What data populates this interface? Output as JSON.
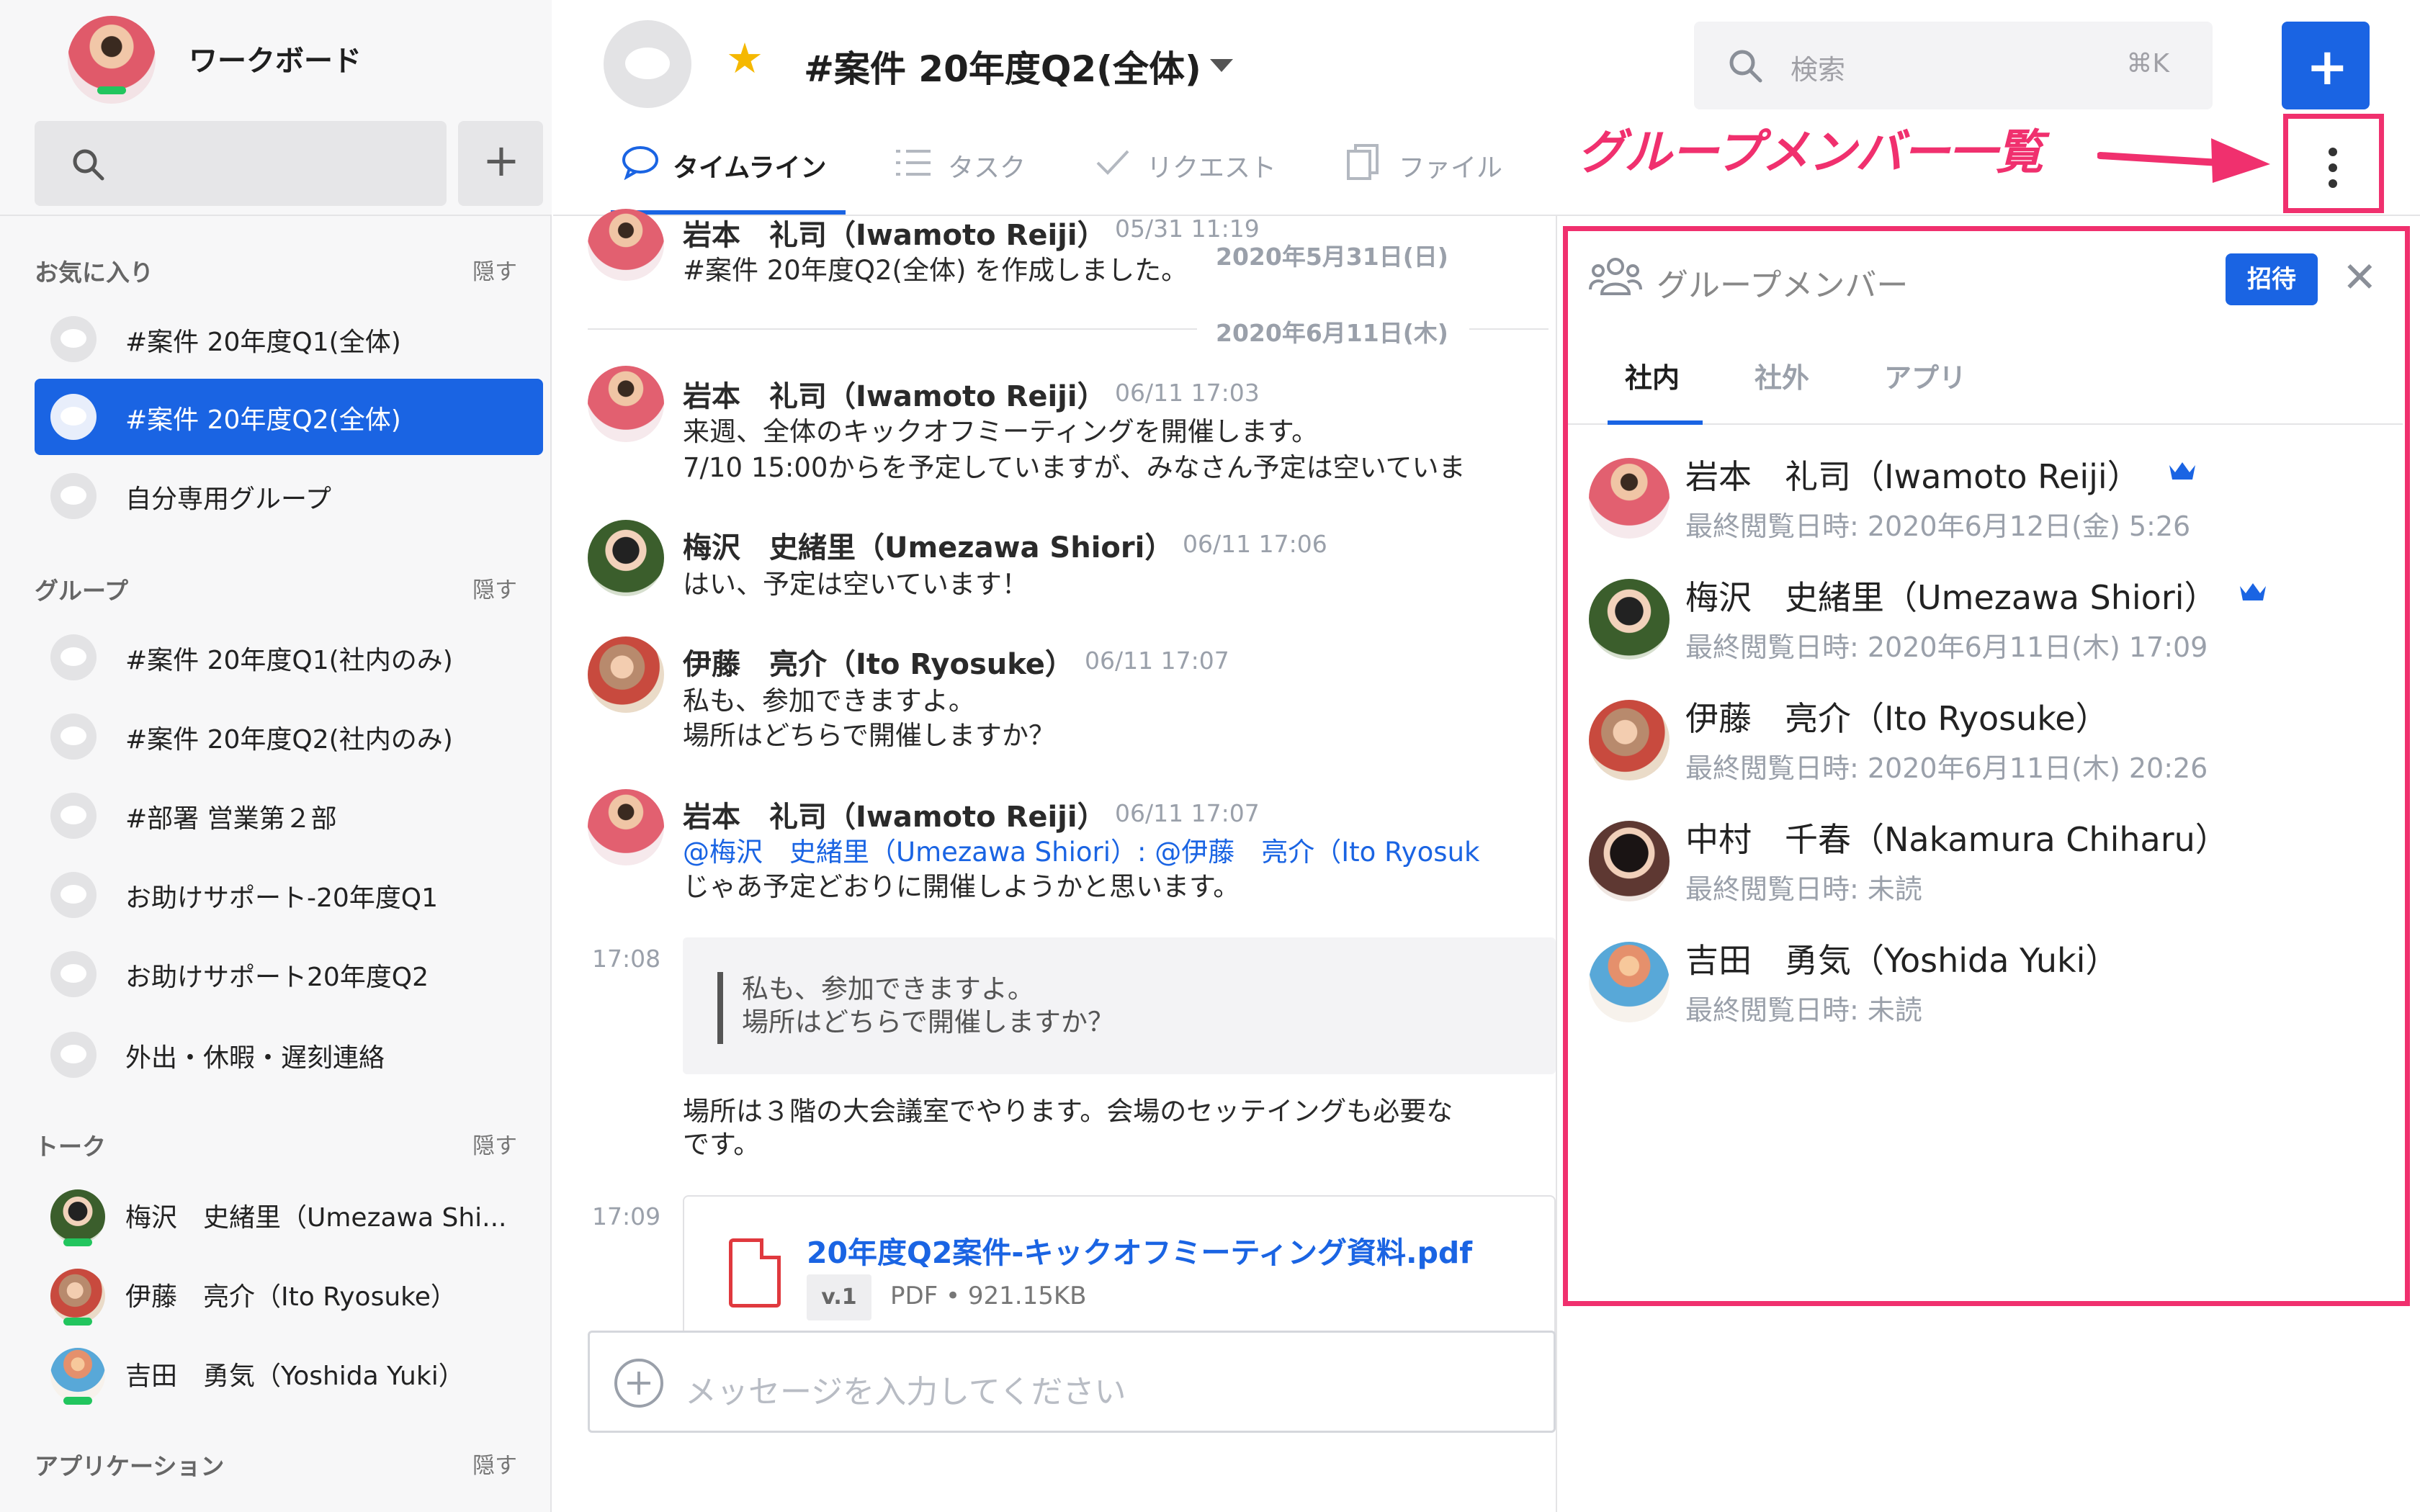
{
  "app": {
    "name": "ワークボード"
  },
  "sidebar": {
    "add_label": "+",
    "favorites": {
      "label": "お気に入り",
      "hide": "隠す",
      "items": [
        {
          "label": "#案件 20年度Q1(全体)",
          "active": false
        },
        {
          "label": "#案件 20年度Q2(全体)",
          "active": true
        },
        {
          "label": "自分専用グループ",
          "active": false
        }
      ]
    },
    "groups": {
      "label": "グループ",
      "hide": "隠す",
      "items": [
        {
          "label": "#案件 20年度Q1(社内のみ)"
        },
        {
          "label": "#案件 20年度Q2(社内のみ)"
        },
        {
          "label": "#部署 営業第２部"
        },
        {
          "label": "お助けサポート-20年度Q1"
        },
        {
          "label": "お助けサポート20年度Q2"
        },
        {
          "label": "外出・休暇・遅刻連絡"
        }
      ]
    },
    "talks": {
      "label": "トーク",
      "hide": "隠す",
      "items": [
        {
          "label": "梅沢　史緒里（Umezawa Shi..."
        },
        {
          "label": "伊藤　亮介（Ito Ryosuke）"
        },
        {
          "label": "吉田　勇気（Yoshida Yuki）"
        }
      ]
    },
    "applications": {
      "label": "アプリケーション",
      "hide": "隠す"
    }
  },
  "header": {
    "channel_title": "#案件 20年度Q2(全体)",
    "search_placeholder": "検索",
    "search_shortcut": "⌘K",
    "new_label": "+",
    "tabs": [
      {
        "label": "タイムライン",
        "active": true
      },
      {
        "label": "タスク",
        "active": false
      },
      {
        "label": "リクエスト",
        "active": false
      },
      {
        "label": "ファイル",
        "active": false
      }
    ]
  },
  "annotation": {
    "label": "グループメンバー一覧",
    "color": "#f0306e"
  },
  "timeline": {
    "date_separators": [
      "2020年5月31日(日)",
      "2020年6月11日(木)"
    ],
    "messages": [
      {
        "name": "岩本　礼司（Iwamoto Reiji）",
        "time": "05/31 11:19",
        "lines": [
          "#案件 20年度Q2(全体) を作成しました。"
        ]
      },
      {
        "name": "岩本　礼司（Iwamoto Reiji）",
        "time": "06/11 17:03",
        "lines": [
          "来週、全体のキックオフミーティングを開催します。",
          "7/10 15:00からを予定していますが、みなさん予定は空いていま"
        ]
      },
      {
        "name": "梅沢　史緒里（Umezawa Shiori）",
        "time": "06/11 17:06",
        "lines": [
          "はい、予定は空いています！"
        ]
      },
      {
        "name": "伊藤　亮介（Ito Ryosuke）",
        "time": "06/11 17:07",
        "lines": [
          "私も、参加できますよ。",
          "場所はどちらで開催しますか？"
        ]
      },
      {
        "name": "岩本　礼司（Iwamoto Reiji）",
        "time": "06/11 17:07",
        "mention_line": "@梅沢　史緒里（Umezawa Shiori）: @伊藤　亮介（Ito Ryosuk",
        "lines": [
          "じゃあ予定どおりに開催しようかと思います。"
        ]
      }
    ],
    "followups": [
      {
        "time": "17:08",
        "quote": [
          "私も、参加できますよ。",
          "場所はどちらで開催しますか？"
        ],
        "lines": [
          "場所は３階の大会議室でやります。会場のセッテイングも必要な",
          "です。"
        ]
      },
      {
        "time": "17:09",
        "file": {
          "name": "20年度Q2案件-キックオフミーティング資料.pdf",
          "version": "v.1",
          "meta": "PDF • 921.15KB"
        }
      }
    ],
    "input_placeholder": "メッセージを入力してください"
  },
  "member_panel": {
    "title": "グループメンバー",
    "invite_label": "招待",
    "tabs": [
      {
        "label": "社内",
        "active": true
      },
      {
        "label": "社外",
        "active": false
      },
      {
        "label": "アプリ",
        "active": false
      }
    ],
    "members": [
      {
        "name": "岩本　礼司（Iwamoto Reiji）",
        "last_seen": "最終閲覧日時: 2020年6月12日(金) 5:26",
        "admin": true
      },
      {
        "name": "梅沢　史緒里（Umezawa Shiori）",
        "last_seen": "最終閲覧日時: 2020年6月11日(木) 17:09",
        "admin": true
      },
      {
        "name": "伊藤　亮介（Ito Ryosuke）",
        "last_seen": "最終閲覧日時: 2020年6月11日(木) 20:26",
        "admin": false
      },
      {
        "name": "中村　千春（Nakamura Chiharu）",
        "last_seen": "最終閲覧日時: 未読",
        "admin": false
      },
      {
        "name": "吉田　勇気（Yoshida Yuki）",
        "last_seen": "最終閲覧日時: 未読",
        "admin": false
      }
    ]
  },
  "colors": {
    "accent": "#1a64e3",
    "annotation": "#f0306e",
    "star": "#f5b800",
    "online": "#22c55e"
  }
}
